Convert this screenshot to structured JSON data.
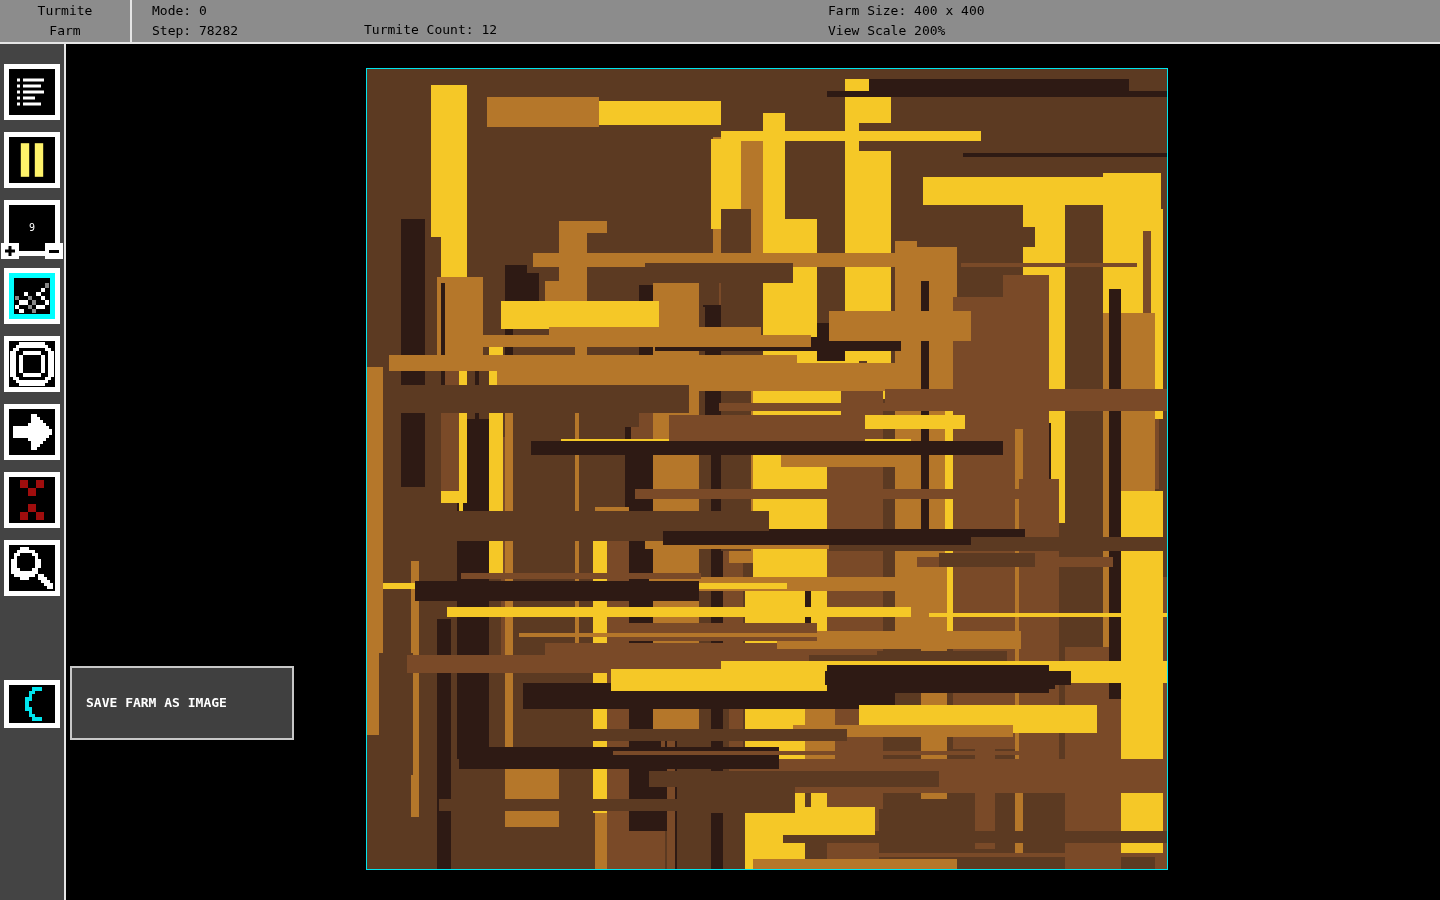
{
  "header": {
    "title_lines": [
      "Turmite",
      "Farm"
    ],
    "mode": "Mode: 0",
    "step": "Step: 78282",
    "turmite_count": "Turmite Count: 12",
    "farm_size": "Farm Size: 400 x 400",
    "view_scale": "View Scale 200%"
  },
  "toolbar": [
    {
      "kind": "menu",
      "selected": false
    },
    {
      "kind": "pause",
      "selected": false
    },
    {
      "kind": "counter",
      "selected": false,
      "value": "9"
    },
    {
      "kind": "pattern",
      "selected": true
    },
    {
      "kind": "ring",
      "selected": false
    },
    {
      "kind": "arrow",
      "selected": false
    },
    {
      "kind": "dots",
      "selected": false
    },
    {
      "kind": "zoom",
      "selected": false
    }
  ],
  "tooltip": {
    "text": "SAVE FARM AS IMAGE"
  }
}
